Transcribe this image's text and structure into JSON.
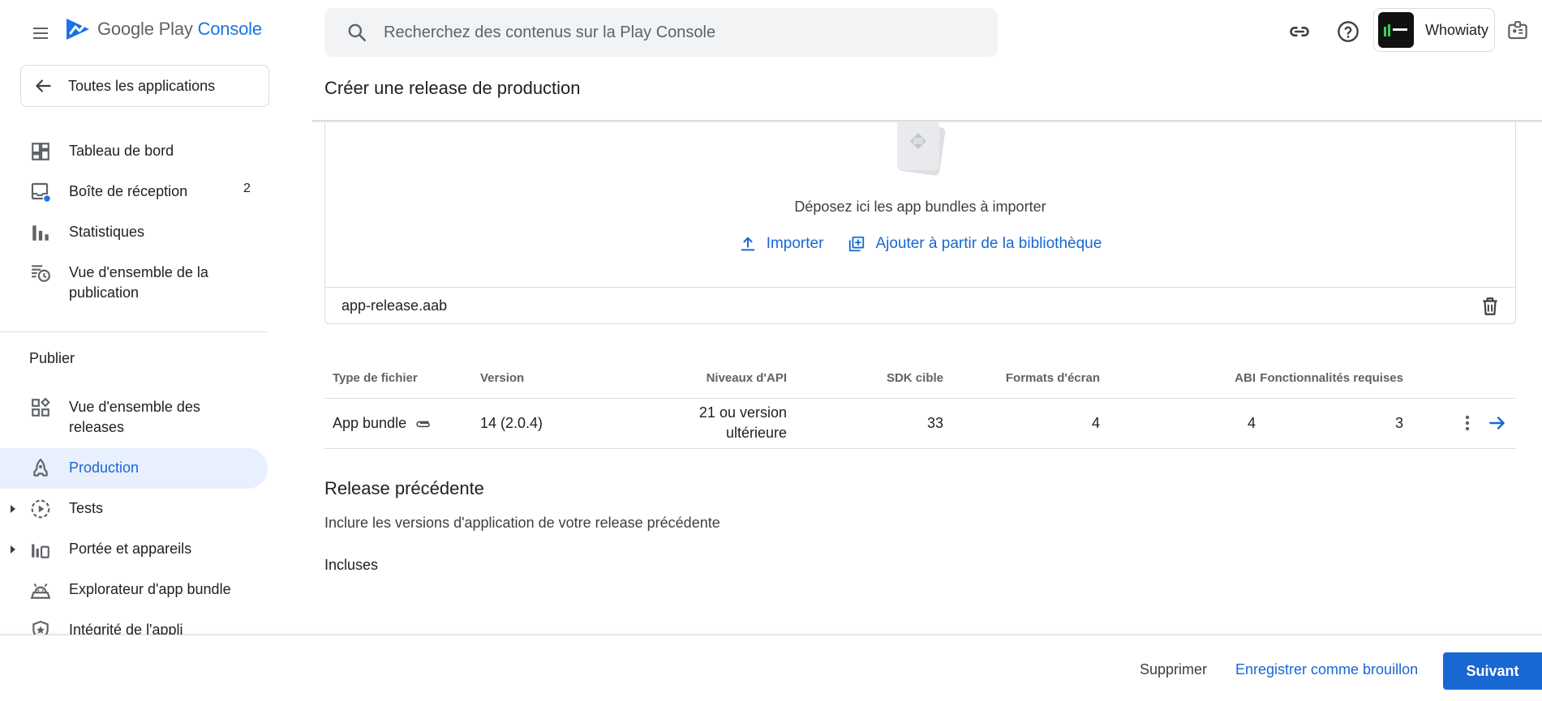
{
  "header": {
    "logo_prefix": "Google Play",
    "logo_brand": "Console",
    "search_placeholder": "Recherchez des contenus sur la Play Console",
    "account_name": "Whowiaty",
    "icons": [
      "menu-icon",
      "search-icon",
      "link-icon",
      "help-icon",
      "notification-badge-icon"
    ]
  },
  "sidebar": {
    "back_label": "Toutes les applications",
    "items": [
      {
        "label": "Tableau de bord",
        "icon": "dashboard-icon"
      },
      {
        "label": "Boîte de réception",
        "count": "2",
        "icon": "inbox-icon"
      },
      {
        "label": "Statistiques",
        "icon": "bar-chart-icon"
      },
      {
        "label": "Vue d'ensemble de la publication",
        "icon": "publishing-overview-icon"
      }
    ],
    "section_publish": "Publier",
    "publish_items": [
      {
        "label": "Vue d'ensemble des releases",
        "icon": "releases-overview-icon"
      },
      {
        "label": "Production",
        "icon": "production-icon",
        "active": true
      },
      {
        "label": "Tests",
        "icon": "testing-icon",
        "expandable": true
      },
      {
        "label": "Portée et appareils",
        "icon": "reach-devices-icon",
        "expandable": true
      },
      {
        "label": "Explorateur d'app bundle",
        "icon": "bundle-explorer-icon"
      },
      {
        "label": "Intégrité de l'appli",
        "icon": "app-integrity-icon"
      }
    ]
  },
  "main": {
    "page_title": "Créer une release de production",
    "drop_text": "Déposez ici les app bundles à importer",
    "import_label": "Importer",
    "library_label": "Ajouter à partir de la bibliothèque",
    "file_name": "app-release.aab",
    "table": {
      "headers": [
        "Type de fichier",
        "Version",
        "Niveaux d'API",
        "SDK cible",
        "Formats d'écran",
        "ABI",
        "Fonctionnalités requises"
      ],
      "rows": [
        {
          "type": "App bundle",
          "version": "14 (2.0.4)",
          "api": "21 ou version ultérieure",
          "sdk": "33",
          "formats": "4",
          "abi": "4",
          "features": "3"
        }
      ]
    },
    "previous_release": {
      "title": "Release précédente",
      "description": "Inclure les versions d'application de votre release précédente",
      "included_label": "Incluses"
    }
  },
  "footer": {
    "delete_label": "Supprimer",
    "draft_label": "Enregistrer comme brouillon",
    "next_label": "Suivant"
  },
  "colors": {
    "accent": "#1967d2",
    "active_bg": "#e8f0fe",
    "text": "#202124",
    "muted": "#5f6368",
    "border": "#dadce0"
  }
}
